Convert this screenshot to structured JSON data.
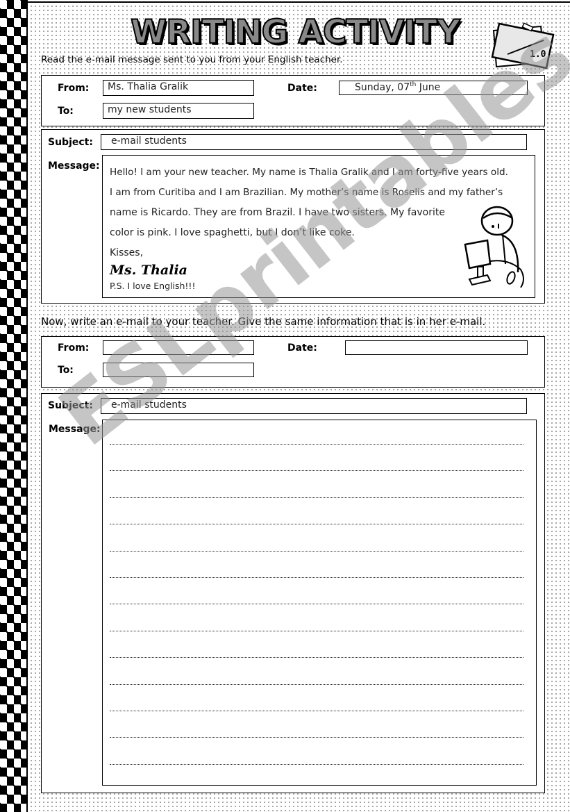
{
  "title": "WRITING ACTIVITY",
  "badge": {
    "icon": "folder-icon",
    "text": "1.0"
  },
  "instructions": {
    "read": "Read the e-mail message sent to you from your English teacher.",
    "write": "Now, write an e-mail to your teacher. Give the same information that is in her e-mail."
  },
  "labels": {
    "from": "From:",
    "to": "To:",
    "date": "Date:",
    "subject": "Subject:",
    "message": "Message:"
  },
  "teacher_email": {
    "from": "Ms. Thalia Gralik",
    "to": "my new students",
    "date_prefix": "Sunday, 07",
    "date_sup": "th",
    "date_suffix": " June",
    "subject": "e-mail students",
    "message_lines": [
      "Hello! I am your new teacher. My name is Thalia Gralik and I am forty-five years old.",
      "I am from Curitiba and I am Brazilian.  My mother’s name is Roselis and my father’s",
      "name is Ricardo. They are from Brazil. I have two sisters. My favorite",
      "color is pink. I love spaghetti, but I don’t like coke."
    ],
    "closing": "Kisses,",
    "signature": "Ms. Thalia",
    "ps": "P.S. I love English!!!",
    "illustration": "child-at-computer-icon"
  },
  "student_email": {
    "from": "",
    "to": "",
    "date": "",
    "subject": "e-mail students",
    "writing_lines": 13
  },
  "watermark": "ESLprintables.com"
}
